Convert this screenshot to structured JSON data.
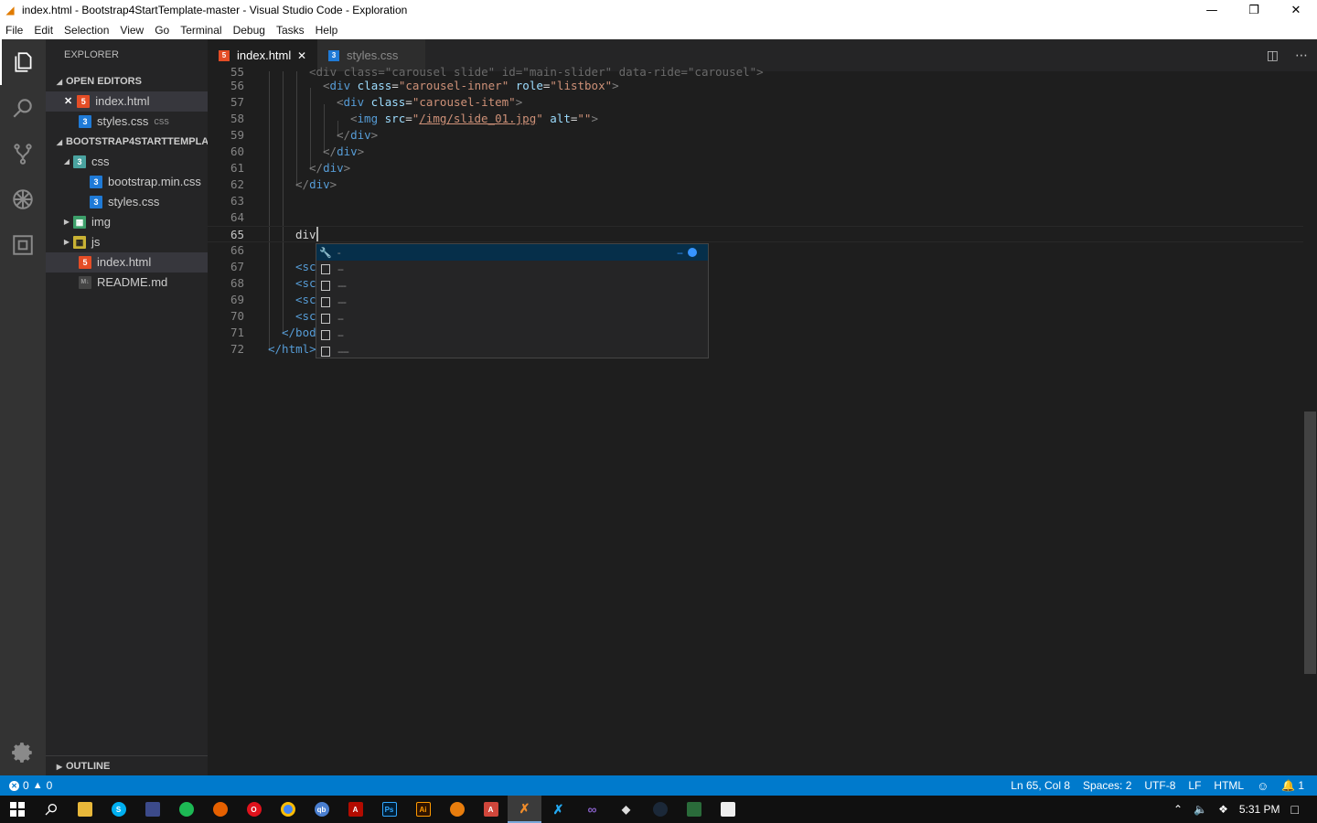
{
  "window": {
    "title": "index.html - Bootstrap4StartTemplate-master - Visual Studio Code - Exploration",
    "minimize": "—",
    "restore": "❐",
    "close": "✕"
  },
  "menu": [
    "File",
    "Edit",
    "Selection",
    "View",
    "Go",
    "Terminal",
    "Debug",
    "Tasks",
    "Help"
  ],
  "sidebar": {
    "title": "EXPLORER",
    "open_editors_label": "OPEN EDITORS",
    "open_editors": [
      {
        "name": "index.html",
        "type": "html",
        "close": "✕"
      },
      {
        "name": "styles.css",
        "type": "css",
        "hint": "css"
      }
    ],
    "project_label": "BOOTSTRAP4STARTTEMPLA...",
    "tree": [
      {
        "name": "css",
        "type": "folder"
      },
      {
        "name": "bootstrap.min.css",
        "type": "css"
      },
      {
        "name": "styles.css",
        "type": "css"
      },
      {
        "name": "img",
        "type": "folder-img"
      },
      {
        "name": "js",
        "type": "folder-js"
      },
      {
        "name": "index.html",
        "type": "html"
      },
      {
        "name": "README.md",
        "type": "md"
      }
    ],
    "outline_label": "OUTLINE"
  },
  "tabs": [
    {
      "name": "index.html",
      "active": true,
      "close": "✕"
    },
    {
      "name": "styles.css",
      "active": false
    }
  ],
  "editor": {
    "lines": [
      {
        "n": "55"
      },
      {
        "n": "56"
      },
      {
        "n": "57"
      },
      {
        "n": "58"
      },
      {
        "n": "59"
      },
      {
        "n": "60"
      },
      {
        "n": "61"
      },
      {
        "n": "62"
      },
      {
        "n": "63"
      },
      {
        "n": "64"
      },
      {
        "n": "65"
      },
      {
        "n": "66"
      },
      {
        "n": "67"
      },
      {
        "n": "68"
      },
      {
        "n": "69"
      },
      {
        "n": "70"
      },
      {
        "n": "71"
      },
      {
        "n": "72"
      }
    ],
    "code": {
      "l55": "<div class=\"carousel slide\" id=\"main-slider\" data-ride=\"carousel\">",
      "l56_tag": "div",
      "l56_attr1": "class",
      "l56_val1": "\"carousel-inner\"",
      "l56_attr2": "role",
      "l56_val2": "\"listbox\"",
      "l57_tag": "div",
      "l57_attr1": "class",
      "l57_val1": "\"carousel-item\"",
      "l58_tag": "img",
      "l58_attr1": "src",
      "l58_q1": "\"",
      "l58_path": "/img/slide_01.jpg",
      "l58_q2": "\"",
      "l58_attr2": "alt",
      "l58_val2": "\"\"",
      "l59": "div",
      "l60": "div",
      "l61": "div",
      "l62": "div",
      "l65": "div",
      "l67": "<sc",
      "l68": "<sc",
      "l69": "<sc",
      "l70": "<sc",
      "l71": "</bod",
      "l72": "</html>"
    }
  },
  "suggest": {
    "rows": [
      "-",
      "--",
      "---",
      "---",
      "--",
      "--",
      "----"
    ]
  },
  "status": {
    "errors": "0",
    "warnings": "0",
    "position": "Ln 65, Col 8",
    "spaces": "Spaces: 2",
    "encoding": "UTF-8",
    "eol": "LF",
    "language": "HTML",
    "notifications": "1"
  },
  "taskbar": {
    "time": "5:31 PM"
  }
}
